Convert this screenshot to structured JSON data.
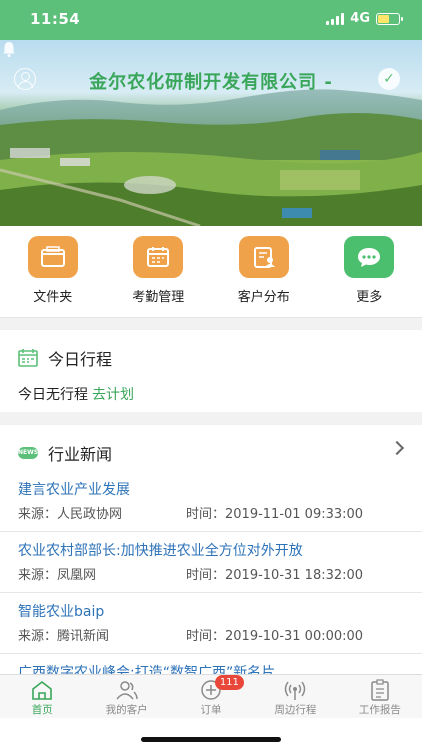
{
  "status_bar": {
    "time": "11:54",
    "network": "4G"
  },
  "header": {
    "title": "金尔农化研制开发有限公司 -"
  },
  "shortcuts": [
    {
      "label": "文件夹",
      "icon": "folder-icon"
    },
    {
      "label": "考勤管理",
      "icon": "calendar-icon"
    },
    {
      "label": "客户分布",
      "icon": "customer-doc-icon"
    },
    {
      "label": "更多",
      "icon": "more-icon"
    }
  ],
  "today": {
    "title": "今日行程",
    "empty_text": "今日无行程",
    "plan_link": "去计划"
  },
  "news": {
    "title": "行业新闻",
    "badge": "NEWS",
    "items": [
      {
        "title": "建言农业产业发展",
        "source": "来源：人民政协网",
        "time": "时间：2019-11-01 09:33:00"
      },
      {
        "title": "农业农村部部长:加快推进农业全方位对外开放",
        "source": "来源：凤凰网",
        "time": "时间：2019-10-31 18:32:00"
      },
      {
        "title": "智能农业baip",
        "source": "来源：腾讯新闻",
        "time": "时间：2019-10-31 00:00:00"
      },
      {
        "title": "广西数字农业峰会:打造“数智广西”新名片",
        "source": "",
        "time": ""
      }
    ]
  },
  "tabbar": {
    "items": [
      {
        "label": "首页",
        "icon": "home-icon",
        "active": true
      },
      {
        "label": "我的客户",
        "icon": "customers-icon"
      },
      {
        "label": "订单",
        "icon": "order-add-icon",
        "badge": "111"
      },
      {
        "label": "周边行程",
        "icon": "nearby-signal-icon"
      },
      {
        "label": "工作报告",
        "icon": "report-clipboard-icon"
      }
    ]
  },
  "colors": {
    "primary": "#5cc07a",
    "accent_text": "#3aa65a",
    "link_blue": "#2e73b8",
    "orange": "#f0a24a",
    "badge_red": "#e9473a"
  }
}
